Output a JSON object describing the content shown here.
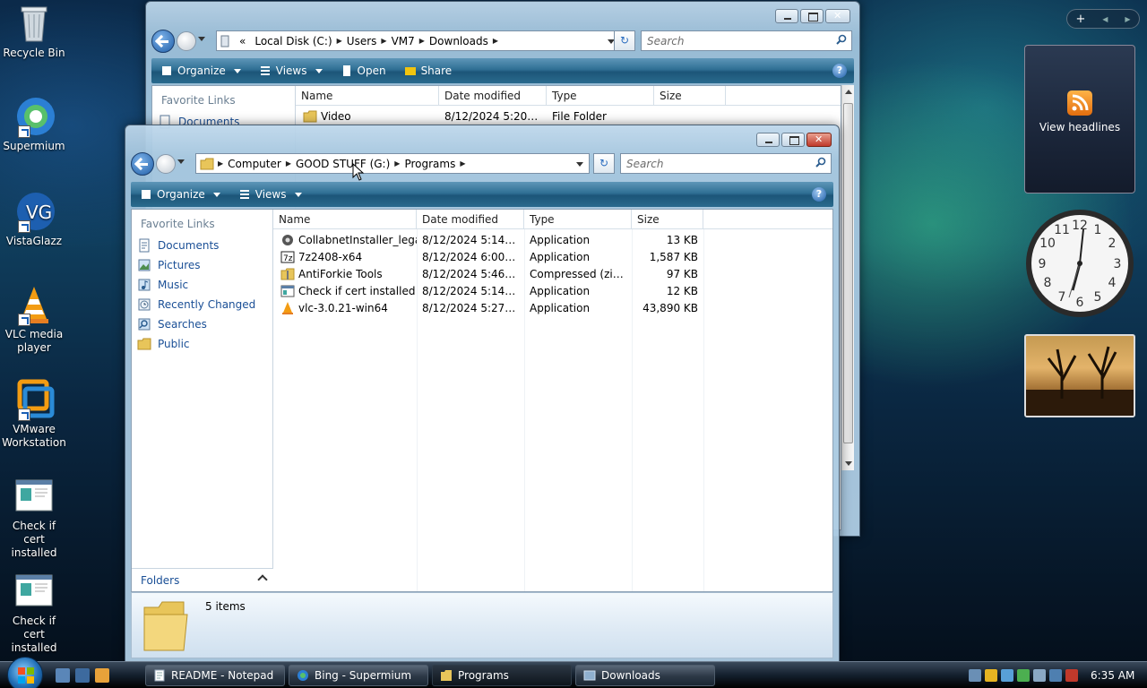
{
  "desktop": {
    "icons": [
      {
        "label": "Recycle Bin"
      },
      {
        "label": "Supermium"
      },
      {
        "label": "VistaGlazz"
      },
      {
        "label": "VLC media player"
      },
      {
        "label": "VMware Workstation"
      },
      {
        "label": "Check if cert installed"
      },
      {
        "label": "Check if cert installed"
      }
    ]
  },
  "back_window": {
    "address": {
      "chevron": "«",
      "segments": [
        "Local Disk (C:)",
        "Users",
        "VM7",
        "Downloads"
      ]
    },
    "search_placeholder": "Search",
    "commands": {
      "organize": "Organize",
      "views": "Views",
      "open": "Open",
      "share": "Share"
    },
    "nav_header": "Favorite Links",
    "nav_first": "Documents",
    "columns": [
      "Name",
      "Date modified",
      "Type",
      "Size"
    ],
    "rows": [
      {
        "name": "Video",
        "date": "8/12/2024 5:20 AM",
        "type": "File Folder",
        "size": ""
      }
    ]
  },
  "front_window": {
    "address": {
      "segments": [
        "Computer",
        "GOOD STUFF (G:)",
        "Programs"
      ]
    },
    "search_placeholder": "Search",
    "commands": {
      "organize": "Organize",
      "views": "Views"
    },
    "nav_header": "Favorite Links",
    "nav_links": [
      "Documents",
      "Pictures",
      "Music",
      "Recently Changed",
      "Searches",
      "Public"
    ],
    "folders_label": "Folders",
    "columns": [
      "Name",
      "Date modified",
      "Type",
      "Size"
    ],
    "rows": [
      {
        "name": "CollabnetInstaller_lega...",
        "date": "8/12/2024 5:14 AM",
        "type": "Application",
        "size": "13 KB",
        "icon": "installer-icon"
      },
      {
        "name": "7z2408-x64",
        "date": "8/12/2024 6:00 AM",
        "type": "Application",
        "size": "1,587 KB",
        "icon": "7zip-icon"
      },
      {
        "name": "AntiForkie Tools",
        "date": "8/12/2024 5:46 AM",
        "type": "Compressed (zipp...",
        "size": "97 KB",
        "icon": "zip-folder-icon"
      },
      {
        "name": "Check if cert installed",
        "date": "8/12/2024 5:14 AM",
        "type": "Application",
        "size": "12 KB",
        "icon": "app-window-icon"
      },
      {
        "name": "vlc-3.0.21-win64",
        "date": "8/12/2024 5:27 AM",
        "type": "Application",
        "size": "43,890 KB",
        "icon": "vlc-cone-icon"
      }
    ],
    "status": "5 items"
  },
  "gadgets": {
    "bar": {
      "add": "+",
      "prev": "◀",
      "next": "▶"
    },
    "rss_label": "View headlines"
  },
  "taskbar": {
    "tasks": [
      "README - Notepad",
      "Bing - Supermium",
      "Programs",
      "Downloads"
    ],
    "active_task": "Programs",
    "time": "6:35 AM"
  },
  "colors": {
    "link_blue": "#1a4f96",
    "command_bar": "#2f6f94",
    "folder_yellow": "#e8c55a"
  }
}
